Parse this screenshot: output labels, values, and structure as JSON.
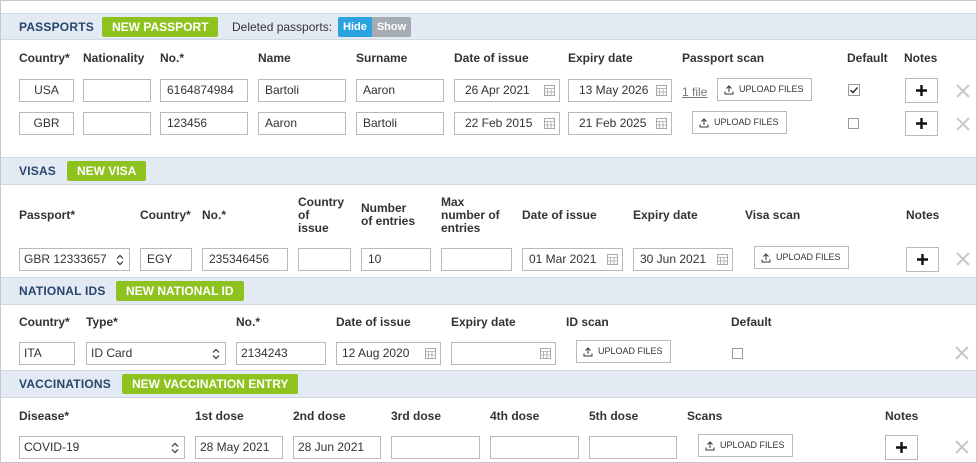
{
  "passports": {
    "title": "PASSPORTS",
    "new_button": "NEW PASSPORT",
    "deleted_label": "Deleted passports:",
    "toggle_hide": "Hide",
    "toggle_show": "Show",
    "columns": [
      "Country*",
      "Nationality",
      "No.*",
      "Name",
      "Surname",
      "Date of issue",
      "Expiry date",
      "Passport scan",
      "Default",
      "Notes"
    ],
    "rows": [
      {
        "country": "USA",
        "nationality": "",
        "number": "6164874984",
        "name": "Bartoli",
        "surname": "Aaron",
        "date_of_issue": "26 Apr 2021",
        "expiry_date": "13 May 2026",
        "files": "1 file",
        "upload": "UPLOAD FILES",
        "default": true
      },
      {
        "country": "GBR",
        "nationality": "",
        "number": "123456",
        "name": "Aaron",
        "surname": "Bartoli",
        "date_of_issue": "22 Feb 2015",
        "expiry_date": "21 Feb 2025",
        "files": "",
        "upload": "UPLOAD FILES",
        "default": false
      }
    ]
  },
  "visas": {
    "title": "VISAS",
    "new_button": "NEW VISA",
    "columns": {
      "passport": "Passport*",
      "country": "Country*",
      "number": "No.*",
      "country_of_issue": [
        "Country",
        "of",
        "issue"
      ],
      "number_of_entries": [
        "Number",
        "of entries"
      ],
      "max_entries": [
        "Max",
        "number of",
        "entries"
      ],
      "date_of_issue": "Date of issue",
      "expiry_date": "Expiry date",
      "visa_scan": "Visa scan",
      "notes": "Notes"
    },
    "row": {
      "passport": "GBR 12333657",
      "country": "EGY",
      "number": "235346456",
      "country_of_issue": "",
      "number_of_entries": "10",
      "max_entries": "",
      "date_of_issue": "01 Mar 2021",
      "expiry_date": "30 Jun 2021",
      "upload": "UPLOAD FILES"
    }
  },
  "national_ids": {
    "title": "NATIONAL IDS",
    "new_button": "NEW NATIONAL ID",
    "columns": {
      "country": "Country*",
      "type": "Type*",
      "number": "No.*",
      "date_of_issue": "Date of issue",
      "expiry_date": "Expiry date",
      "id_scan": "ID scan",
      "default": "Default"
    },
    "row": {
      "country": "ITA",
      "type": "ID Card",
      "number": "2134243",
      "date_of_issue": "12 Aug 2020",
      "expiry_date": "",
      "upload": "UPLOAD FILES",
      "default": false
    }
  },
  "vaccinations": {
    "title": "VACCINATIONS",
    "new_button": "NEW VACCINATION ENTRY",
    "columns": {
      "disease": "Disease*",
      "dose1": "1st dose",
      "dose2": "2nd dose",
      "dose3": "3rd dose",
      "dose4": "4th dose",
      "dose5": "5th dose",
      "scans": "Scans",
      "notes": "Notes"
    },
    "row": {
      "disease": "COVID-19",
      "dose1": "28 May 2021",
      "dose2": "28 Jun 2021",
      "dose3": "",
      "dose4": "",
      "dose5": "",
      "upload": "UPLOAD FILES"
    }
  },
  "icons": {
    "calendar": "calendar-icon",
    "upload": "upload-icon",
    "plus": "plus-icon",
    "delete": "close-icon",
    "select": "chevron-updown-icon"
  },
  "colors": {
    "accent_green": "#8dc21f",
    "header_bg": "#e3eaf3",
    "title_blue": "#27466e",
    "toggle_active": "#2aa3e0"
  }
}
